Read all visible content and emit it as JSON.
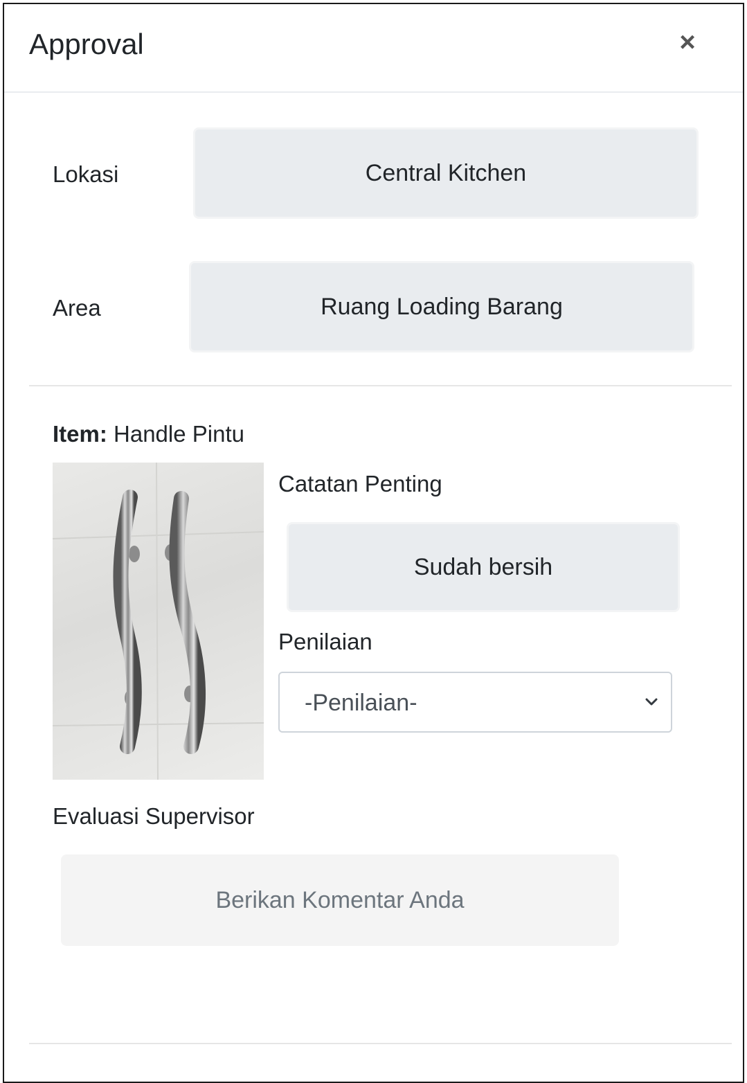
{
  "modal": {
    "title": "Approval",
    "close_glyph": "×"
  },
  "fields": {
    "lokasi_label": "Lokasi",
    "lokasi_value": "Central Kitchen",
    "area_label": "Area",
    "area_value": "Ruang Loading Barang"
  },
  "item": {
    "prefix": "Item:",
    "name": "Handle Pintu",
    "photo_icon": "door-handle-photo"
  },
  "notes": {
    "label": "Catatan Penting",
    "value": "Sudah bersih"
  },
  "rating": {
    "label": "Penilaian",
    "selected": "-Penilaian-",
    "icon": "chevron-down-icon"
  },
  "evaluation": {
    "label": "Evaluasi Supervisor",
    "placeholder": "Berikan Komentar Anda"
  }
}
